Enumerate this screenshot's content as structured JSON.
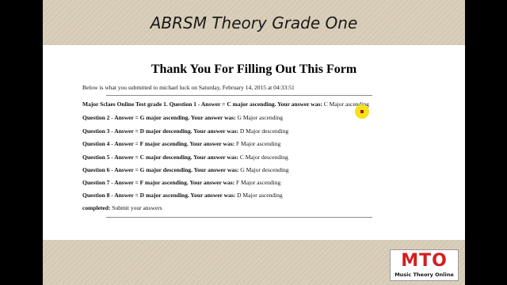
{
  "slide": {
    "title": "ABRSM Theory Grade One"
  },
  "form": {
    "title": "Thank You For Filling Out This Form",
    "submitted_text": "Below is what you submitted to michael luck on Saturday, February 14, 2015 at 04:33:51",
    "entries": [
      {
        "question": "Major Sclaes Online Test grade 1. Question 1 - Answer = C major ascending. Your answer was:",
        "answer": "C Major ascending"
      },
      {
        "question": "Question 2 - Answer = G major ascending. Your answer was:",
        "answer": "G Major ascending"
      },
      {
        "question": "Question 3 - Answer = D major descending. Your answer was:",
        "answer": "D Major descending"
      },
      {
        "question": "Question 4 - Answer = F major ascending. Your answer was:",
        "answer": "F Major ascending"
      },
      {
        "question": "Question 5 - Answer = C major descending. Your answer was:",
        "answer": "C Major descending"
      },
      {
        "question": "Question 6 - Answer = G major descending. Your answer was:",
        "answer": "G Major descending"
      },
      {
        "question": "Question 7 - Answer = F major ascending. Your answer was:",
        "answer": "F Major ascending"
      },
      {
        "question": "Question 8 - Answer = D major ascending. Your answer was:",
        "answer": "D Major ascending"
      },
      {
        "question": "completed:",
        "answer": "Submit your answers"
      }
    ]
  },
  "logo": {
    "mark": "MTO",
    "subtitle": "Music Theory Online",
    "color": "#d21f1f"
  },
  "colors": {
    "cursor_highlight": "#f4e000",
    "cursor": "#c0001b"
  }
}
